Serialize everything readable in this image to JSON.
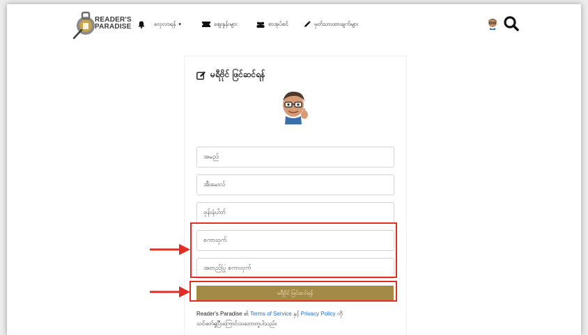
{
  "brand": {
    "line1": "READER'S",
    "line2": "PARADISE"
  },
  "nav": {
    "items": [
      {
        "label": "လှေလာရန်",
        "icon": "bell-icon",
        "has_dropdown": true
      },
      {
        "label": "ဈေးနှုန်းများ",
        "icon": "ticket-icon"
      },
      {
        "label": "စာအုပ်စင်",
        "icon": "users-icon"
      },
      {
        "label": "မှတ်သားထားချက်များ",
        "icon": "pen-icon"
      }
    ],
    "search_icon": "search-icon"
  },
  "signup": {
    "title": "မရီဗိုင် ဖြင်ဆင်ရန်",
    "fields": [
      {
        "placeholder": "အမည်"
      },
      {
        "placeholder": "အီးမေးလ်"
      },
      {
        "placeholder": "ဖုန်းနံပါတ်"
      },
      {
        "placeholder": "စကားဝှက်"
      },
      {
        "placeholder": "အတည်ပြု စကားဝှက်"
      }
    ],
    "submit_label": "မရီဗိုင် ဖြင်ဆင်ရန်",
    "terms": {
      "prefix": "Reader's Paradise ၏",
      "tos": "Terms of Service",
      "and": "နှင့်",
      "privacy": "Privacy Policy",
      "suffix": "ကို",
      "line2": "သင်ဖတ်ရှုပြီးကြောင်းသဘောတူပါသည်။"
    }
  },
  "colors": {
    "accent": "#a48a47",
    "highlight": "#e42d22",
    "link": "#1f6fd1"
  }
}
